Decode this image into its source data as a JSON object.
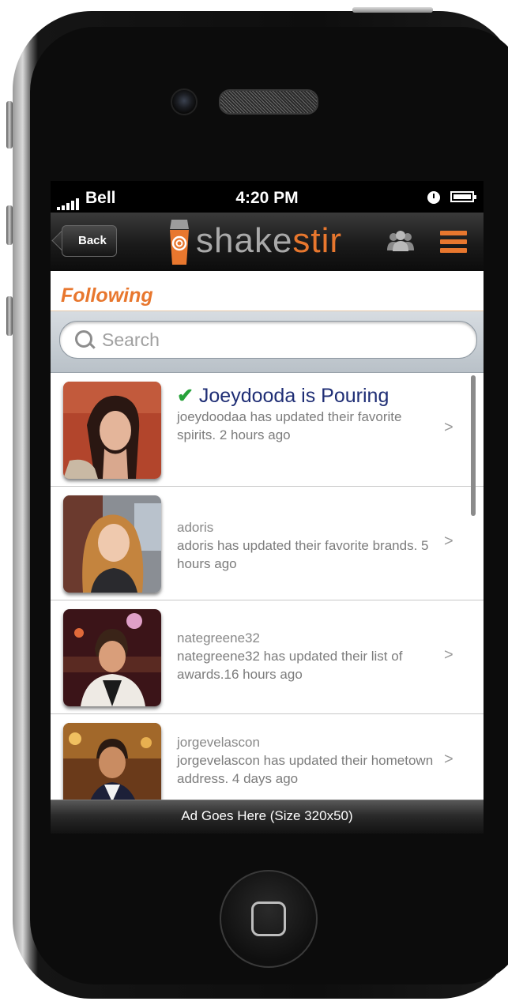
{
  "status_bar": {
    "carrier": "Bell",
    "time": "4:20 PM"
  },
  "nav_bar": {
    "back_label": "Back",
    "logo_text_left": "shake",
    "logo_text_right": "stir",
    "brand_color": "#e8772e",
    "icons": [
      "people-icon",
      "hamburger-menu-icon"
    ]
  },
  "section": {
    "title": "Following"
  },
  "search": {
    "placeholder": "Search",
    "value": ""
  },
  "feed": [
    {
      "name": "Joeydooda is Pouring",
      "status_icon": "checkmark-icon",
      "message": "joeydoodaa has updated their favorite spirits. 2 hours ago",
      "chevron": ">"
    },
    {
      "name": "adoris",
      "message": "adoris has updated their favorite brands. 5 hours ago",
      "chevron": ">"
    },
    {
      "name": "nategreene32",
      "message": "nategreene32 has updated their list of awards.16 hours ago",
      "chevron": ">"
    },
    {
      "name": "jorgevelascon",
      "message": "jorgevelascon has updated their hometown address. 4 days ago",
      "chevron": ">"
    }
  ],
  "ad": {
    "label": "Ad Goes Here (Size 320x50)"
  }
}
